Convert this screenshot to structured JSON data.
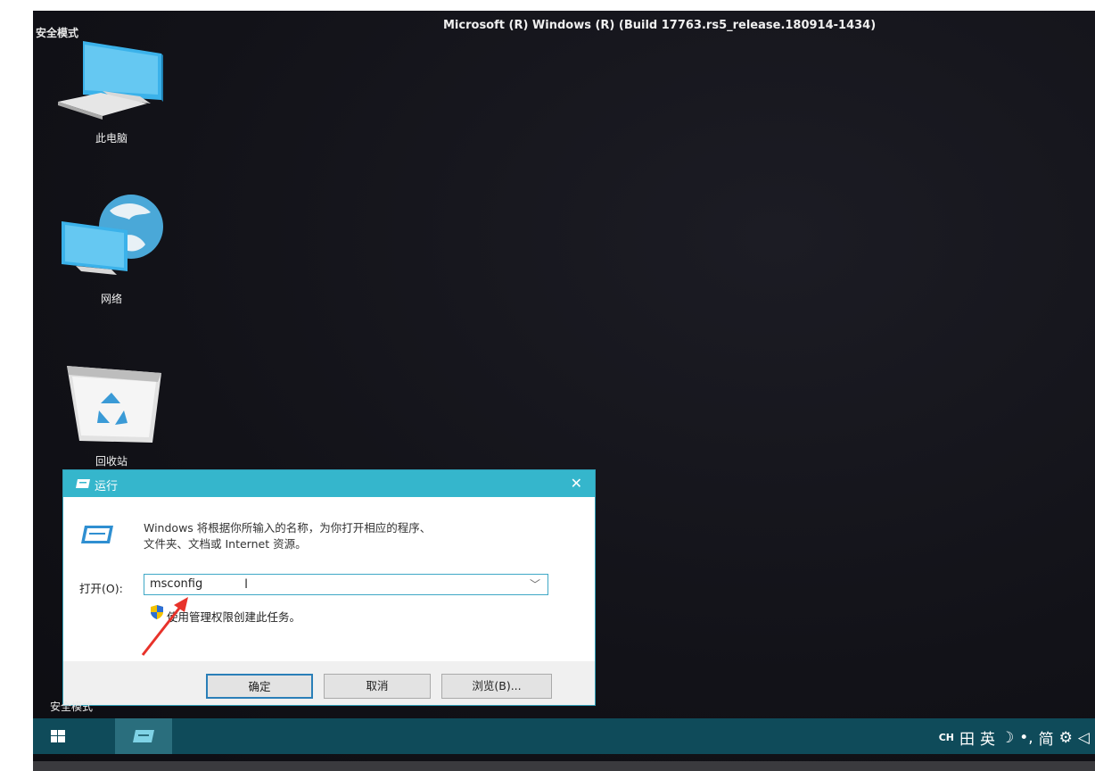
{
  "header": {
    "safe_mode_label": "安全模式",
    "build_text": "Microsoft (R) Windows (R) (Build 17763.rs5_release.180914-1434)",
    "safe_mode_label_bottom": "安全模式"
  },
  "desktop": {
    "icons": [
      {
        "label": "此电脑",
        "icon": "this-pc-icon"
      },
      {
        "label": "网络",
        "icon": "network-icon"
      },
      {
        "label": "回收站",
        "icon": "recycle-bin-icon"
      }
    ]
  },
  "run_dialog": {
    "title": "运行",
    "close": "✕",
    "description_line1": "Windows 将根据你所输入的名称，为你打开相应的程序、",
    "description_line2": "文件夹、文档或 Internet 资源。",
    "open_label": "打开(O):",
    "input_value": "msconfig",
    "admin_note": "使用管理权限创建此任务。",
    "buttons": {
      "ok": "确定",
      "cancel": "取消",
      "browse": "浏览(B)..."
    }
  },
  "taskbar": {
    "tray": {
      "ck": "CH",
      "ime_grid": "田",
      "lang": "英",
      "moon": "☽",
      "dot": "•,",
      "simplified": "简",
      "gear": "⚙",
      "speaker": "◁"
    }
  },
  "colors": {
    "accent": "#35b6cc",
    "taskbar": "#0f4b5a",
    "arrow": "#e8322a"
  }
}
